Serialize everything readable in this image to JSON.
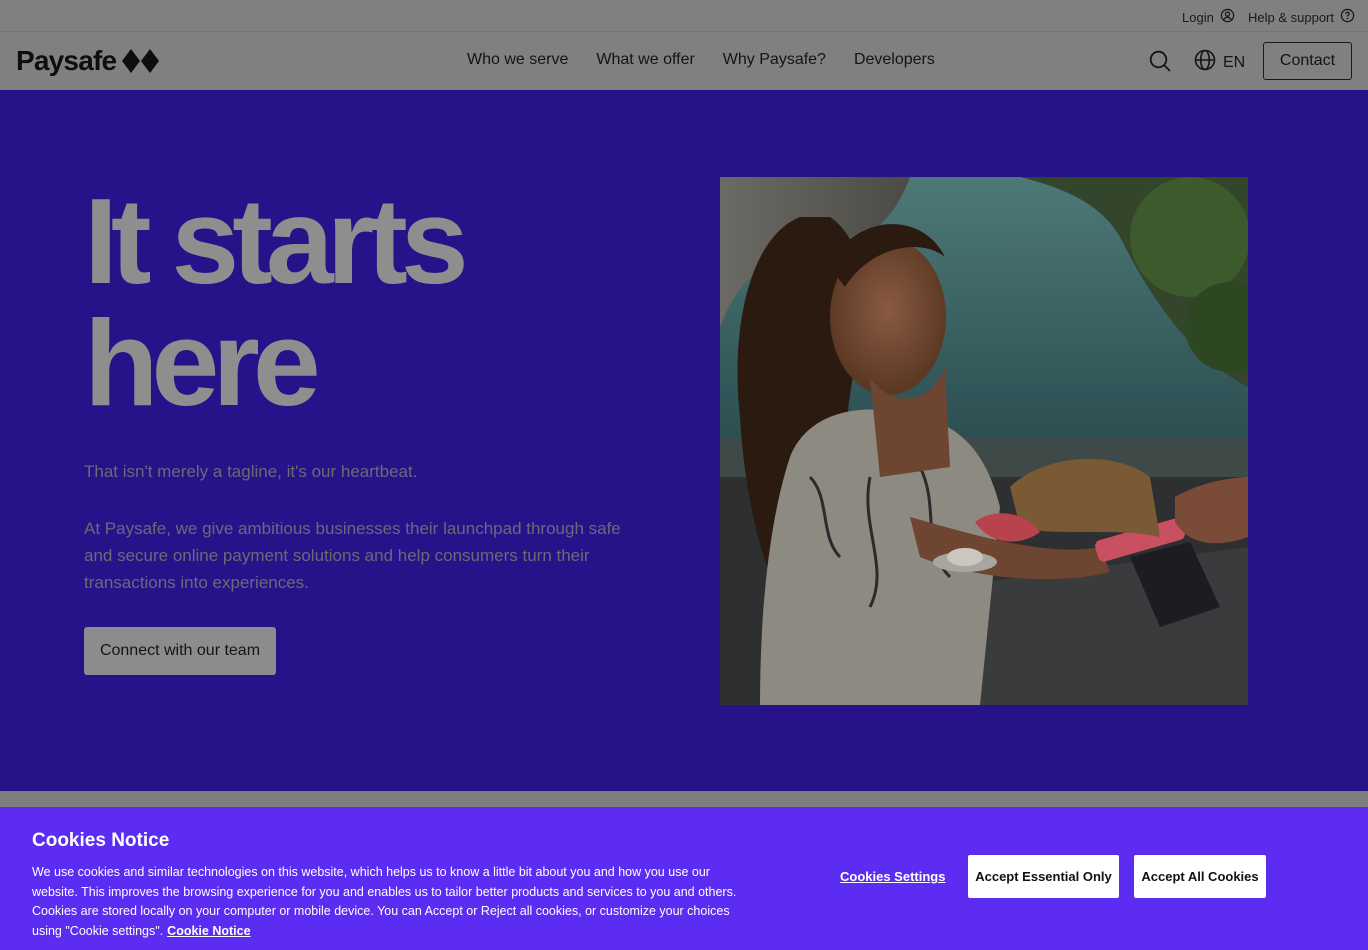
{
  "utility": {
    "login_label": "Login",
    "help_label": "Help & support"
  },
  "nav": {
    "logo_text": "Paysafe",
    "links": [
      {
        "label": "Who we serve"
      },
      {
        "label": "What we offer"
      },
      {
        "label": "Why Paysafe?"
      },
      {
        "label": "Developers"
      }
    ],
    "language": "EN",
    "contact_label": "Contact",
    "icons": [
      "search-icon",
      "globe-icon",
      "user-circle-icon",
      "help-circle-icon"
    ]
  },
  "hero": {
    "title_line1": "It starts",
    "title_line2": "here",
    "tagline": "That isn't merely a tagline, it's our heartbeat.",
    "body": "At Paysafe, we give ambitious businesses their launchpad through safe and secure online payment solutions and help consumers turn their transactions into experiences.",
    "cta_label": "Connect with our team"
  },
  "cookies": {
    "title": "Cookies Notice",
    "text": "We use cookies and similar technologies on this website, which helps us to know a little bit about you and how you use our website. This improves the browsing experience for you and enables us to tailor better products and services to you and others. Cookies are stored locally on your computer or mobile device. You can Accept or Reject all cookies, or customize your choices using \"Cookie settings\".",
    "notice_link": "Cookie Notice",
    "settings_label": "Cookies Settings",
    "essential_label": "Accept Essential Only",
    "all_label": "Accept All Cookies"
  },
  "colors": {
    "hero_bg": "#27128a",
    "cookie_bg": "#5c2cf2",
    "overlay_gray": "#808080"
  }
}
